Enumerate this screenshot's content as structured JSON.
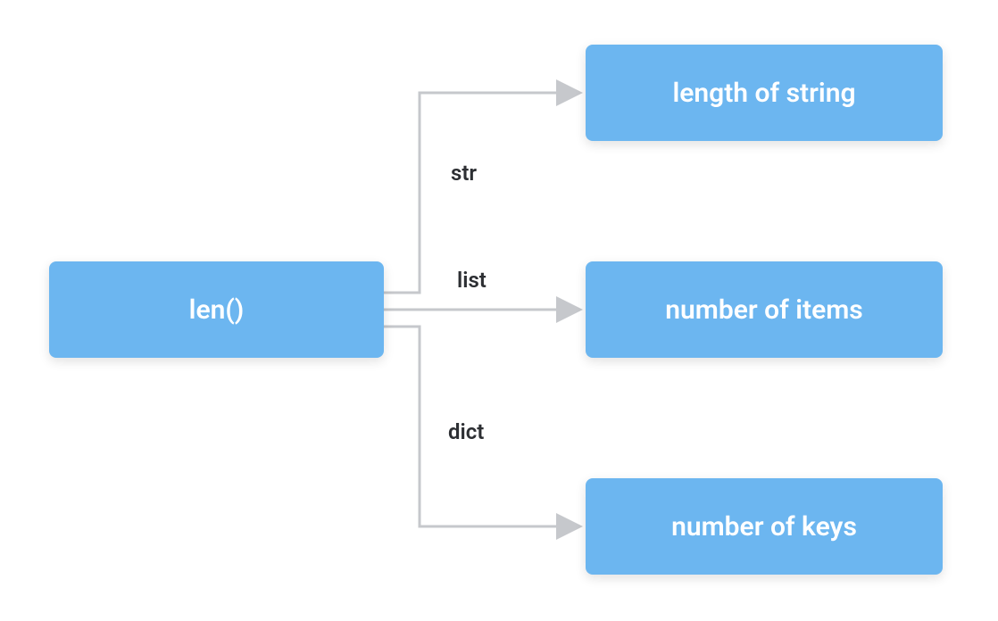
{
  "diagram": {
    "source": {
      "label": "len()"
    },
    "targets": [
      {
        "label": "length of string",
        "edge_label": "str"
      },
      {
        "label": "number of items",
        "edge_label": "list"
      },
      {
        "label": "number of keys",
        "edge_label": "dict"
      }
    ],
    "colors": {
      "node_bg": "#6cb6f0",
      "node_text": "#ffffff",
      "connector": "#c6c8cc",
      "edge_label": "#2d2f33"
    }
  }
}
